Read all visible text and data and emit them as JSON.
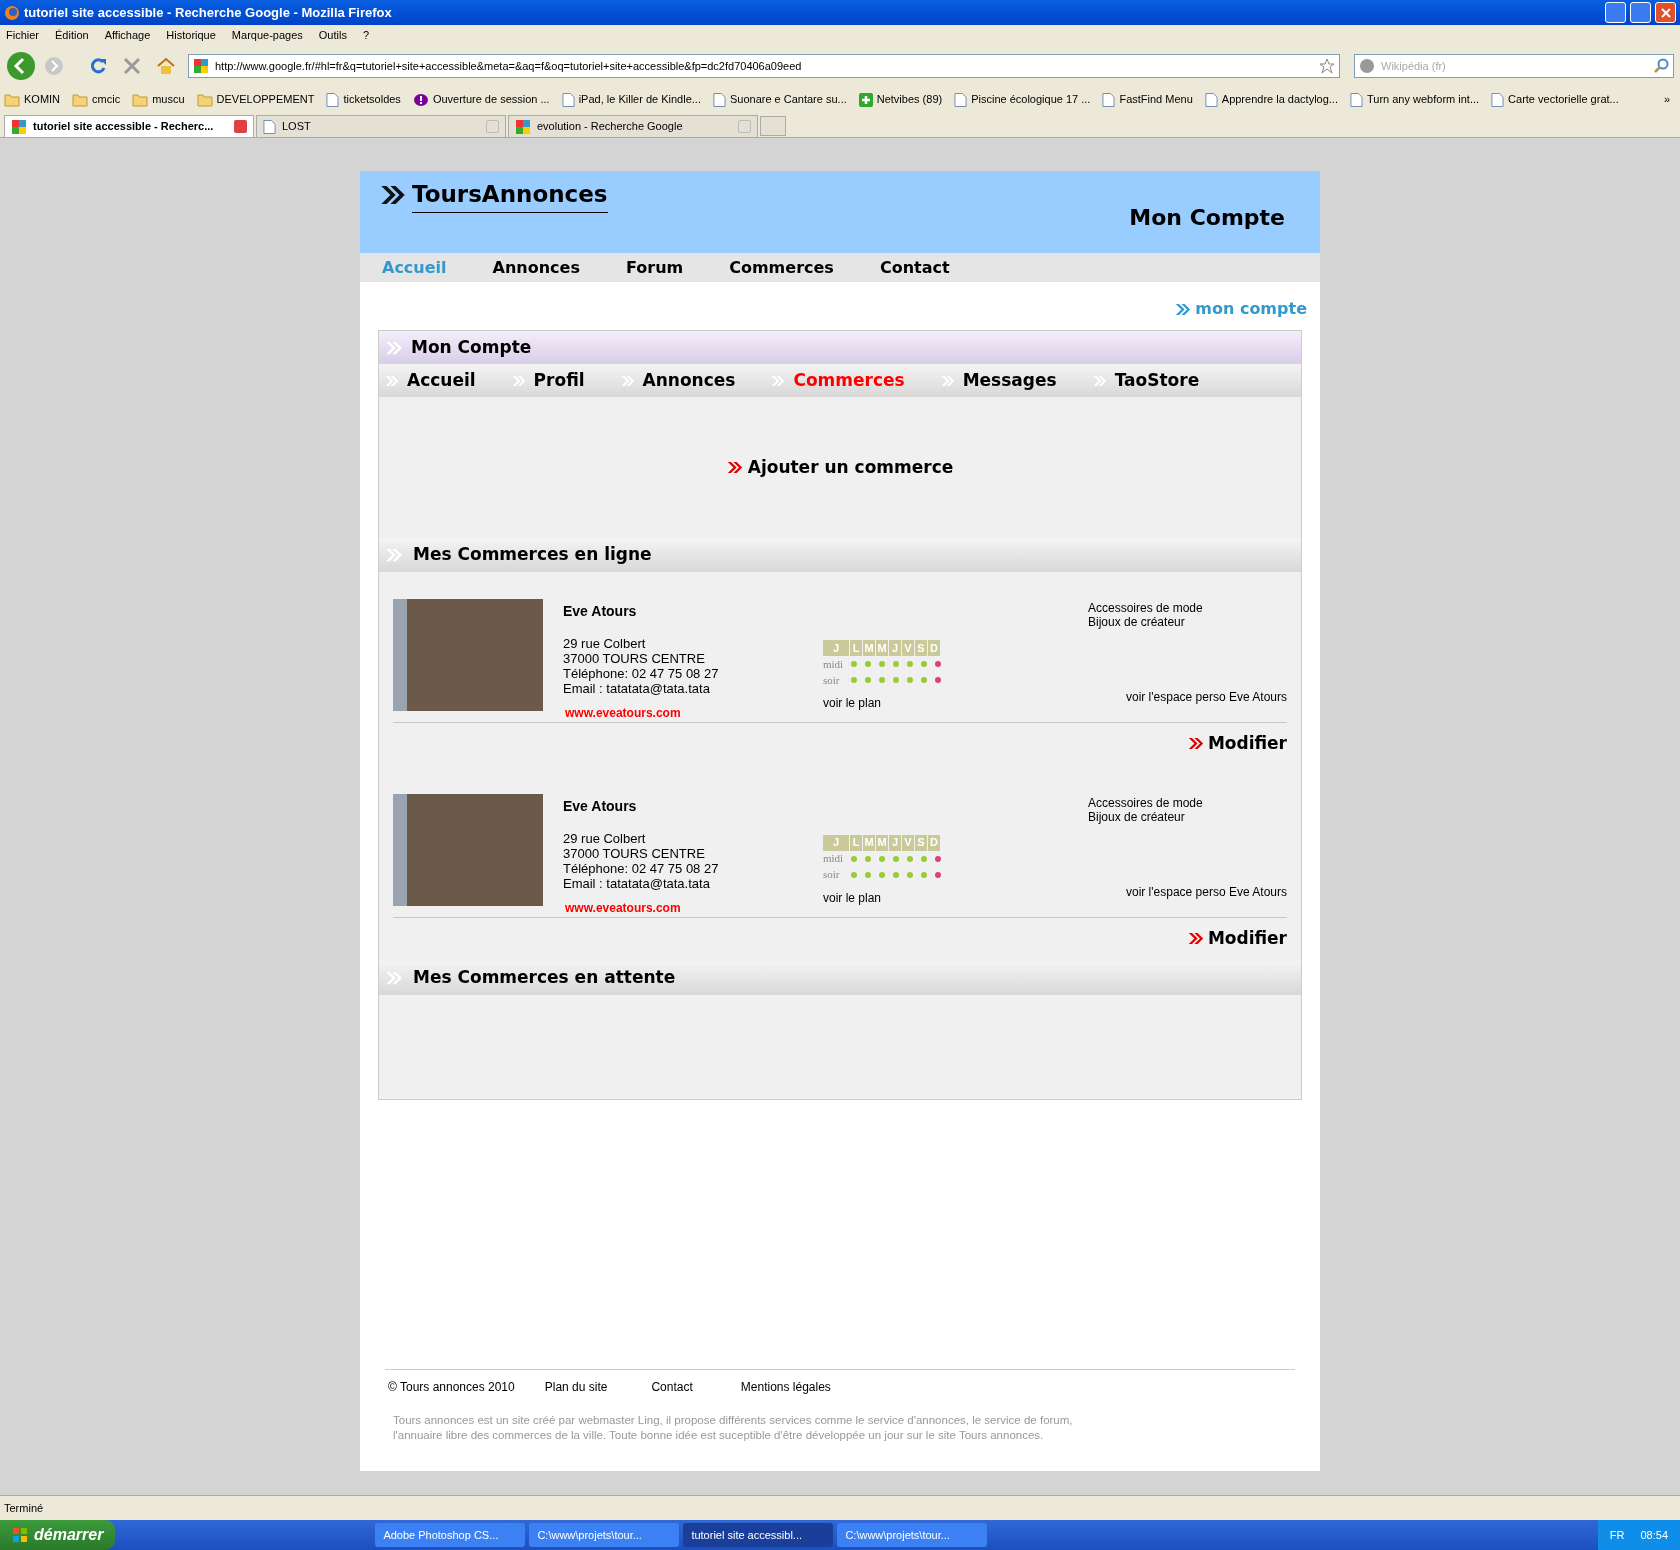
{
  "window": {
    "title": "tutoriel site accessible - Recherche Google - Mozilla Firefox"
  },
  "menu": [
    "Fichier",
    "Édition",
    "Affichage",
    "Historique",
    "Marque-pages",
    "Outils",
    "?"
  ],
  "address": {
    "value": "http://www.google.fr/#hl=fr&q=tutoriel+site+accessible&meta=&aq=f&oq=tutoriel+site+accessible&fp=dc2fd70406a09eed"
  },
  "search": {
    "placeholder": "Wikipédia (fr)"
  },
  "bookmarks": [
    {
      "label": "KOMIN",
      "kind": "folder"
    },
    {
      "label": "cmcic",
      "kind": "folder"
    },
    {
      "label": "muscu",
      "kind": "folder"
    },
    {
      "label": "DEVELOPPEMENT",
      "kind": "folder"
    },
    {
      "label": "ticketsoldes",
      "kind": "page"
    },
    {
      "label": "Ouverture de session ...",
      "kind": "yahoo"
    },
    {
      "label": "iPad, le Killer de Kindle...",
      "kind": "page"
    },
    {
      "label": "Suonare e Cantare su...",
      "kind": "page"
    },
    {
      "label": "Netvibes (89)",
      "kind": "plus"
    },
    {
      "label": "Piscine écologique 17 ...",
      "kind": "page"
    },
    {
      "label": "FastFind Menu",
      "kind": "page"
    },
    {
      "label": "Apprendre la dactylog...",
      "kind": "page"
    },
    {
      "label": "Turn any webform int...",
      "kind": "page"
    },
    {
      "label": "Carte vectorielle grat...",
      "kind": "page"
    }
  ],
  "bookmarks_more": "»",
  "tabs": [
    {
      "label": "tutoriel site accessible - Recherc...",
      "selected": true,
      "kind": "google"
    },
    {
      "label": "LOST",
      "selected": false,
      "kind": "page"
    },
    {
      "label": "evolution - Recherche Google",
      "selected": false,
      "kind": "google"
    }
  ],
  "site": {
    "logo": "ToursAnnonces",
    "page_title": "Mon Compte",
    "nav": [
      {
        "label": "Accueil",
        "selected": true
      },
      {
        "label": "Annonces",
        "selected": false
      },
      {
        "label": "Forum",
        "selected": false
      },
      {
        "label": "Commerces",
        "selected": false
      },
      {
        "label": "Contact",
        "selected": false
      }
    ],
    "account_link": "mon compte",
    "panel_title": "Mon Compte",
    "subnav": [
      {
        "label": "Accueil",
        "selected": false
      },
      {
        "label": "Profil",
        "selected": false
      },
      {
        "label": "Annonces",
        "selected": false
      },
      {
        "label": "Commerces",
        "selected": true
      },
      {
        "label": "Messages",
        "selected": false
      },
      {
        "label": "TaoStore",
        "selected": false
      }
    ],
    "add_link": "Ajouter un commerce",
    "online_title": "Mes Commerces en ligne",
    "commerces": [
      {
        "name": "Eve Atours",
        "address": "29 rue Colbert",
        "city": "37000 TOURS CENTRE",
        "phone": "Téléphone: 02 47 75 08 27",
        "email": "Email : tatatata@tata.tata",
        "website": "www.eveatours.com",
        "days_label": "J",
        "days": [
          "L",
          "M",
          "M",
          "J",
          "V",
          "S",
          "D"
        ],
        "midi_label": "midi",
        "soir_label": "soir",
        "midi": [
          true,
          true,
          true,
          true,
          true,
          true,
          false
        ],
        "soir": [
          true,
          true,
          true,
          true,
          true,
          true,
          false
        ],
        "map_link": "voir le plan",
        "categories": [
          "Accessoires de mode",
          "Bijoux de créateur"
        ],
        "space_link": "voir l'espace perso Eve Atours",
        "edit": "Modifier"
      },
      {
        "name": "Eve Atours",
        "address": "29 rue Colbert",
        "city": "37000 TOURS CENTRE",
        "phone": "Téléphone: 02 47 75 08 27",
        "email": "Email : tatatata@tata.tata",
        "website": "www.eveatours.com",
        "days_label": "J",
        "days": [
          "L",
          "M",
          "M",
          "J",
          "V",
          "S",
          "D"
        ],
        "midi_label": "midi",
        "soir_label": "soir",
        "midi": [
          true,
          true,
          true,
          true,
          true,
          true,
          false
        ],
        "soir": [
          true,
          true,
          true,
          true,
          true,
          true,
          false
        ],
        "map_link": "voir le plan",
        "categories": [
          "Accessoires de mode",
          "Bijoux de créateur"
        ],
        "space_link": "voir l'espace perso Eve Atours",
        "edit": "Modifier"
      }
    ],
    "pending_title": "Mes Commerces en attente",
    "footer_links": [
      "© Tours annonces 2010",
      "Plan du site",
      "Contact",
      "Mentions légales"
    ],
    "footer_text": "Tours annonces est un site créé par webmaster Ling, il propose différents services comme le service d'annonces, le service de forum, l'annuaire libre des commerces de la ville. Toute bonne idée est suceptible d'être développée un jour sur le site Tours annonces."
  },
  "status_bar": "Terminé",
  "taskbar": {
    "start": "démarrer",
    "items": [
      {
        "label": "Adobe Photoshop CS...",
        "selected": false
      },
      {
        "label": "C:\\www\\projets\\tour...",
        "selected": false
      },
      {
        "label": "tutoriel site accessibl...",
        "selected": true
      },
      {
        "label": "C:\\www\\projets\\tour...",
        "selected": false
      }
    ],
    "language": "FR",
    "clock": "08:54"
  }
}
